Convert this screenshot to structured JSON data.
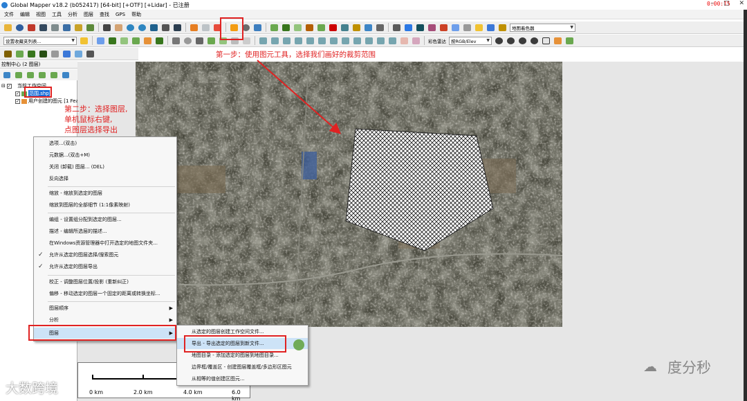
{
  "window": {
    "title": "Global Mapper v18.2 (b052417) [64-bit] [+OTF] [+Lidar] - 已注册",
    "rec_time": "0:00:15"
  },
  "menubar": [
    "文件",
    "编辑",
    "视图",
    "工具",
    "分析",
    "图层",
    "查找",
    "GPS",
    "帮助"
  ],
  "toolbar": {
    "shader_combo": "地图着色器",
    "favorites_combo": "设置收藏夹列表...",
    "color_label": "彩色雷达",
    "color_combo": "按RGB/Elev"
  },
  "control_center": {
    "title": "控制中心 (2 图层)",
    "tree": {
      "root": "当前工作空间",
      "layer1": "范围.shp",
      "layer2": "用户创建的图元 [1 Fea"
    }
  },
  "context_menu": {
    "items": [
      "选项...(双击)",
      "元数据...(双击+M)",
      "关闭 (卸载) 图层... (DEL)",
      "反向选择",
      "缩放 - 缩放到选定的图层",
      "缩放到图层的全部细节 (1:1像素映射)",
      "编组 - 设置组分配到选定的图层...",
      "描述 - 编辑所选层的描述...",
      "在Windows资源管理器中打开选定的地图文件夹...",
      "允许从选定的图层选择/搜索图元",
      "允许从选定的图层导出",
      "校正 - 调整图层位置/投影 (重新纠正)",
      "偏移 - 移动选定的图层一个固定的距离或转换坐标...",
      "图层顺序",
      "分析",
      "图层"
    ]
  },
  "submenu": {
    "items": [
      "从选定的图层创建工作空间文件...",
      "导出 - 导出选定的图层到新文件...",
      "地图目录 - 添加选定的图层到地图目录...",
      "边界框/覆盖区 - 创建图层覆盖框/多边形区图元",
      "从相等的值创建区图元..."
    ]
  },
  "scale": {
    "labels": [
      "0 km",
      "2.0 km",
      "4.0 km",
      "6.0 km"
    ]
  },
  "annotations": {
    "step1": "第一步：使用图元工具，选择我们画好的裁剪范围",
    "step2": [
      "第二步：选择图层,",
      "单机鼠标右键,",
      "点图层选择导出"
    ]
  },
  "watermarks": {
    "left": "大数跨境",
    "right": "度分秒"
  },
  "colors": {
    "annotation_red": "#e02222",
    "selection_blue": "#1e6fd9"
  }
}
